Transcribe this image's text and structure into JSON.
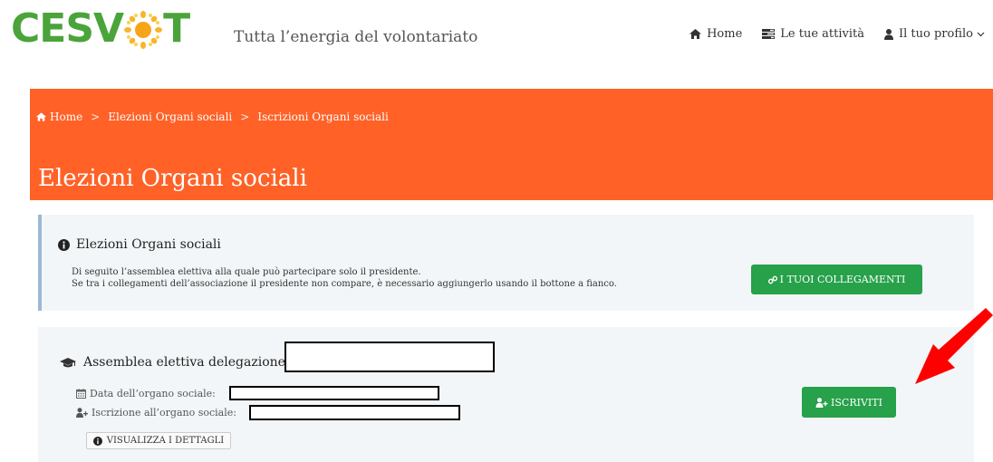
{
  "header": {
    "logo_text_left": "CESV",
    "logo_text_right": "T",
    "tagline": "Tutta l’energia del volontariato",
    "nav": [
      {
        "label": "Home",
        "icon": "home-icon"
      },
      {
        "label": "Le tue attività",
        "icon": "tasks-icon"
      },
      {
        "label": "Il tuo profilo",
        "icon": "user-icon",
        "has_dropdown": true
      }
    ]
  },
  "breadcrumb": {
    "items": [
      "Home",
      "Elezioni Organi sociali",
      "Iscrizioni Organi sociali"
    ],
    "separator": ">"
  },
  "page_title": "Elezioni Organi sociali",
  "info_box": {
    "title": "Elezioni Organi sociali",
    "line1": "Di seguito l’assemblea elettiva alla quale può partecipare solo il presidente.",
    "line2": "Se tra i collegamenti dell’associazione il presidente non compare, è necessario aggiungerlo usando il bottone a fianco.",
    "button_label": "I TUOI COLLEGAMENTI"
  },
  "assembly": {
    "title": "Assemblea elettiva delegazione di",
    "date_label": "Data dell’organo sociale:",
    "registration_label": "Iscrizione all’organo sociale:",
    "details_button": "VISUALIZZA I DETTAGLI",
    "register_button": "ISCRIVITI"
  },
  "colors": {
    "brand_green": "#4aa43a",
    "banner_orange": "#ff6127",
    "button_green": "#27a14a",
    "annotation_red": "#ff0000"
  }
}
